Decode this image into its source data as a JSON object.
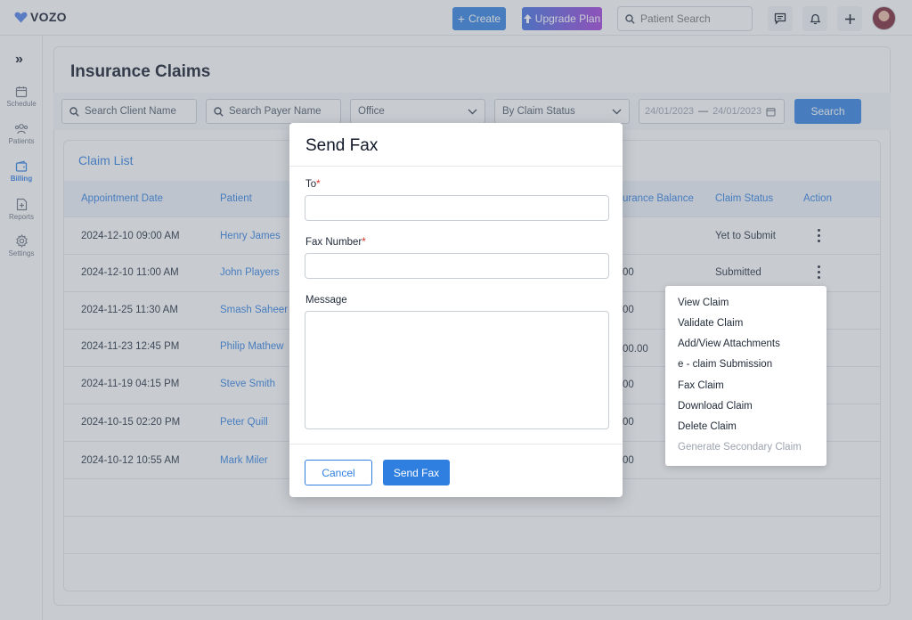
{
  "app": {
    "logo_text": "VOZO",
    "brand_color": "#2f7fe0",
    "logo_heart_color": "#4f7fe8"
  },
  "topbar": {
    "create_label": "Create",
    "upgrade_label": "Upgrade Plan",
    "patient_search_placeholder": "Patient Search",
    "icons": [
      "chat-icon",
      "bell-icon",
      "plus-icon"
    ]
  },
  "sidebar": {
    "items": [
      {
        "label": "Schedule",
        "icon": "calendar-icon",
        "active": false
      },
      {
        "label": "Patients",
        "icon": "users-icon",
        "active": false
      },
      {
        "label": "Billing",
        "icon": "wallet-icon",
        "active": true
      },
      {
        "label": "Reports",
        "icon": "report-icon",
        "active": false
      },
      {
        "label": "Settings",
        "icon": "gear-icon",
        "active": false
      }
    ]
  },
  "page": {
    "title": "Insurance Claims"
  },
  "filters": {
    "client_placeholder": "Search Client Name",
    "payer_placeholder": "Search Payer Name",
    "office_value": "Office",
    "status_value": "By Claim Status",
    "date_from": "24/01/2023",
    "date_sep": "—",
    "date_to": "24/01/2023",
    "search_label": "Search"
  },
  "claim_list": {
    "title": "Claim List",
    "columns": {
      "appointment_date": "Appointment Date",
      "patient": "Patient",
      "insurance_balance": "urance Balance",
      "claim_status": "Claim Status",
      "action": "Action"
    },
    "rows": [
      {
        "date": "2024-12-10 09:00 AM",
        "patient": "Henry James",
        "balance": "",
        "status": "Yet to Submit"
      },
      {
        "date": "2024-12-10 11:00 AM",
        "patient": "John Players",
        "balance": "00",
        "status": "Submitted"
      },
      {
        "date": "2024-11-25 11:30 AM",
        "patient": "Smash Saheer",
        "balance": "00",
        "status": ""
      },
      {
        "date": "2024-11-23 12:45 PM",
        "patient": "Philip Mathew",
        "balance": "00.00",
        "status": ""
      },
      {
        "date": "2024-11-19 04:15 PM",
        "patient": "Steve Smith",
        "balance": "00",
        "status": ""
      },
      {
        "date": "2024-10-15 02:20 PM",
        "patient": "Peter Quill",
        "balance": "00",
        "status": ""
      },
      {
        "date": "2024-10-12 10:55 AM",
        "patient": "Mark Miler",
        "balance": "00",
        "status": ""
      }
    ]
  },
  "action_menu": {
    "items": [
      {
        "label": "View Claim",
        "disabled": false
      },
      {
        "label": "Validate Claim",
        "disabled": false
      },
      {
        "label": "Add/View Attachments",
        "disabled": false
      },
      {
        "label": "e - claim Submission",
        "disabled": false
      },
      {
        "label": "Fax Claim",
        "disabled": false
      },
      {
        "label": "Download Claim",
        "disabled": false
      },
      {
        "label": "Delete Claim",
        "disabled": false
      },
      {
        "label": "Generate Secondary Claim",
        "disabled": true
      }
    ]
  },
  "modal": {
    "title": "Send Fax",
    "to_label": "To",
    "fax_label": "Fax Number",
    "message_label": "Message",
    "required_mark": "*",
    "to_value": "",
    "fax_value": "",
    "message_value": "",
    "cancel_label": "Cancel",
    "send_label": "Send Fax"
  }
}
